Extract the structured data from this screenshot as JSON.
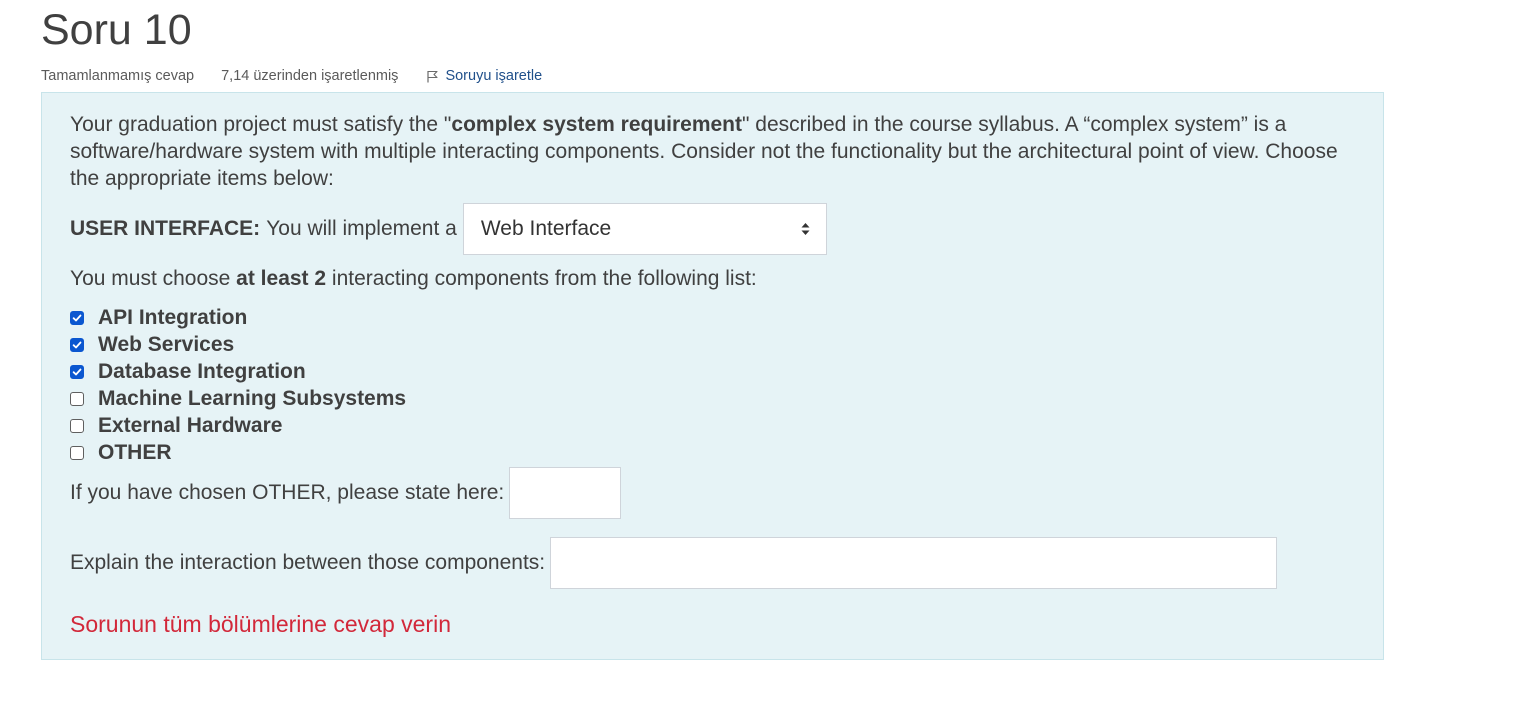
{
  "question": {
    "title": "Soru 10",
    "state": "Tamamlanmamış cevap",
    "grade": "7,14 üzerinden işaretlenmiş",
    "flag_label": "Soruyu işaretle",
    "flag_icon": "flag-icon"
  },
  "prompt": {
    "part1": "Your graduation project must satisfy the \"",
    "bold": "complex system requirement",
    "part2": "\" described in the course syllabus. A “complex system” is a software/hardware system with multiple interacting components. Consider not the functionality but the architectural point of view.  Choose the appropriate items below:"
  },
  "ui_select": {
    "label": "USER INTERFACE:",
    "text": "You will implement a",
    "value": "Web Interface",
    "icon": "select-arrows-icon"
  },
  "choose": {
    "before": "You must choose ",
    "bold": "at least 2",
    "after": " interacting components from the following list:"
  },
  "options": [
    {
      "label": "API Integration",
      "checked": true
    },
    {
      "label": "Web Services",
      "checked": true
    },
    {
      "label": "Database Integration",
      "checked": true
    },
    {
      "label": "Machine Learning Subsystems",
      "checked": false
    },
    {
      "label": "External Hardware",
      "checked": false
    },
    {
      "label": "OTHER",
      "checked": false
    }
  ],
  "other": {
    "label": "If you have chosen OTHER, please state here:",
    "value": ""
  },
  "explain": {
    "label": "Explain the interaction between those components:",
    "value": ""
  },
  "error": "Sorunun tüm bölümlerine cevap verin",
  "colors": {
    "box_bg": "#e6f3f6",
    "checkbox_checked": "#0b57d0",
    "error": "#d2283a",
    "link": "#1f4f8a"
  }
}
